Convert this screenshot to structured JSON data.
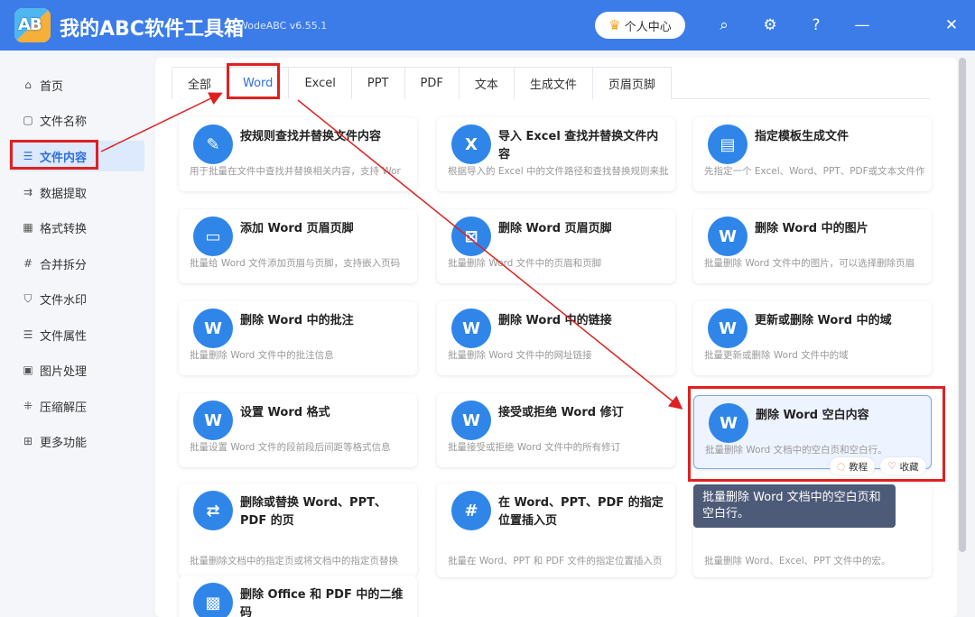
{
  "app": {
    "logo_text": "AB",
    "title": "我的ABC软件工具箱",
    "version": "WodeABC v6.55.1",
    "user_center": "个人中心"
  },
  "titlebar_icons": [
    "search-icon",
    "gear-icon",
    "help-icon",
    "minimize-icon",
    "close-icon"
  ],
  "sidebar": {
    "items": [
      {
        "label": "首页",
        "icon": "home-icon"
      },
      {
        "label": "文件名称",
        "icon": "file-icon"
      },
      {
        "label": "文件内容",
        "icon": "list-icon",
        "active": true
      },
      {
        "label": "数据提取",
        "icon": "extract-icon"
      },
      {
        "label": "格式转换",
        "icon": "grid-icon"
      },
      {
        "label": "合并拆分",
        "icon": "hash-icon"
      },
      {
        "label": "文件水印",
        "icon": "shield-icon"
      },
      {
        "label": "文件属性",
        "icon": "list-icon"
      },
      {
        "label": "图片处理",
        "icon": "image-icon"
      },
      {
        "label": "压缩解压",
        "icon": "compress-icon"
      },
      {
        "label": "更多功能",
        "icon": "apps-icon"
      }
    ]
  },
  "tabs": [
    {
      "label": "全部"
    },
    {
      "label": "Word",
      "active": true
    },
    {
      "label": "Excel"
    },
    {
      "label": "PPT"
    },
    {
      "label": "PDF"
    },
    {
      "label": "文本"
    },
    {
      "label": "生成文件"
    },
    {
      "label": "页眉页脚"
    }
  ],
  "cards": [
    {
      "title": "按规则查找并替换文件内容",
      "desc": "用于批量在文件中查找并替换相关内容，支持 Wor",
      "icon": "edit-doc-icon"
    },
    {
      "title": "导入 Excel 查找并替换文件内容",
      "desc": "根据导入的 Excel 中的文件路径和查找替换规则来批",
      "icon": "excel-edit-icon"
    },
    {
      "title": "指定模板生成文件",
      "desc": "先指定一个 Excel、Word、PPT、PDF或文本文件作",
      "icon": "template-icon"
    },
    {
      "title": "添加 Word 页眉页脚",
      "desc": "批量给 Word 文件添加页眉与页脚，支持嵌入页码",
      "icon": "header-footer-icon"
    },
    {
      "title": "删除 Word 页眉页脚",
      "desc": "批量删除 Word 文件中的页眉和页脚",
      "icon": "delete-header-icon"
    },
    {
      "title": "删除 Word 中的图片",
      "desc": "批量删除 Word 文件中的图片，可以选择删除页眉",
      "icon": "delete-image-icon"
    },
    {
      "title": "删除 Word 中的批注",
      "desc": "批量删除 Word 文件中的批注信息",
      "icon": "delete-comment-icon"
    },
    {
      "title": "删除 Word 中的链接",
      "desc": "批量删除 Word 文件中的网址链接",
      "icon": "delete-link-icon"
    },
    {
      "title": "更新或删除 Word 中的域",
      "desc": "批量更新或删除 Word 文件中的域",
      "icon": "field-icon"
    },
    {
      "title": "设置 Word 格式",
      "desc": "批量设置 Word 文件的段前段后间距等格式信息",
      "icon": "format-icon"
    },
    {
      "title": "接受或拒绝 Word 修订",
      "desc": "批量接受或拒绝 Word 文件中的所有修订",
      "icon": "revision-icon"
    },
    {
      "title": "删除 Word 空白内容",
      "desc": "批量删除 Word 文档中的空白页和空白行。",
      "icon": "delete-blank-icon"
    },
    {
      "title": "删除或替换 Word、PPT、PDF 的页",
      "desc": "批量删除文档中的指定页或将文档中的指定页替换",
      "icon": "replace-page-icon"
    },
    {
      "title": "在 Word、PPT、PDF 的指定位置插入页",
      "desc": "批量在 Word、PPT 和 PDF 文件的指定位置插入页",
      "icon": "insert-page-icon"
    },
    {
      "title": "",
      "desc": "批量删除 Word、Excel、PPT 文件中的宏。",
      "icon": ""
    },
    {
      "title": "删除 Office 和 PDF 中的二维码",
      "desc": "",
      "icon": "qrcode-icon"
    }
  ],
  "card_actions": {
    "tutorial": "教程",
    "favorite": "收藏"
  },
  "tooltip": "批量删除 Word 文档中的空白页和空白行。"
}
